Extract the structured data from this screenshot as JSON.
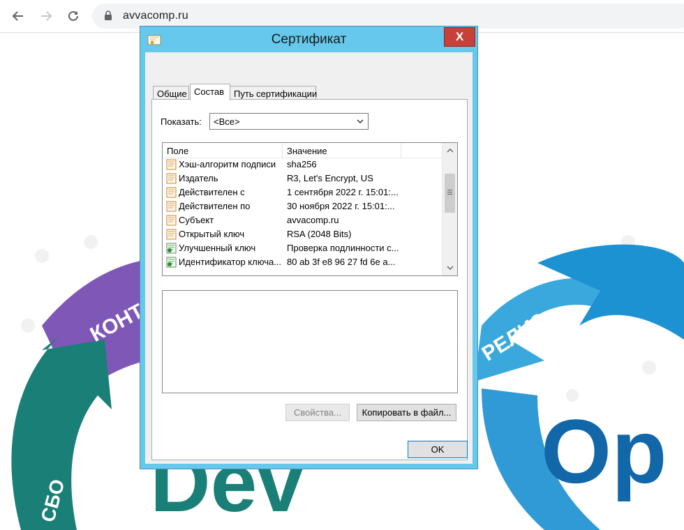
{
  "browser": {
    "url": "avvacomp.ru",
    "icons": [
      "back-arrow-icon",
      "forward-arrow-icon",
      "reload-icon",
      "lock-icon"
    ]
  },
  "background": {
    "words": [
      "КОНТР",
      "РЕЛИЗ",
      "СБО",
      "Dev",
      "Op"
    ],
    "colors": {
      "purple": "#7e57b7",
      "teal": "#1a7f76",
      "blue": "#2f9ad6",
      "darkblue": "#1167a8"
    }
  },
  "dialog": {
    "title": "Сертификат",
    "close_symbol": "X",
    "tabs": [
      "Общие",
      "Состав",
      "Путь сертификации"
    ],
    "active_tab": 1,
    "show_label": "Показать:",
    "show_value": "<Все>",
    "columns": [
      "Поле",
      "Значение"
    ],
    "rows": [
      {
        "field": "Хэш-алгоритм подписи",
        "value": "sha256",
        "icon": "certificate-field-icon"
      },
      {
        "field": "Издатель",
        "value": "R3, Let's Encrypt, US",
        "icon": "certificate-field-icon"
      },
      {
        "field": "Действителен с",
        "value": "1 сентября 2022 г. 15:01:...",
        "icon": "certificate-field-icon"
      },
      {
        "field": "Действителен по",
        "value": "30 ноября 2022 г. 15:01:...",
        "icon": "certificate-field-icon"
      },
      {
        "field": "Субъект",
        "value": "avvacomp.ru",
        "icon": "certificate-field-icon"
      },
      {
        "field": "Открытый ключ",
        "value": "RSA (2048 Bits)",
        "icon": "certificate-field-icon"
      },
      {
        "field": "Улучшенный ключ",
        "value": "Проверка подлинности с...",
        "icon": "extension-field-icon"
      },
      {
        "field": "Идентификатор ключа...",
        "value": "80 ab 3f e8 96 27 fd 6e a...",
        "icon": "extension-field-icon"
      }
    ],
    "properties_button": "Свойства...",
    "copy_button": "Копировать в файл...",
    "ok_button": "OK",
    "colors": {
      "frame": "#65c8ec",
      "close": "#c7403a"
    }
  }
}
